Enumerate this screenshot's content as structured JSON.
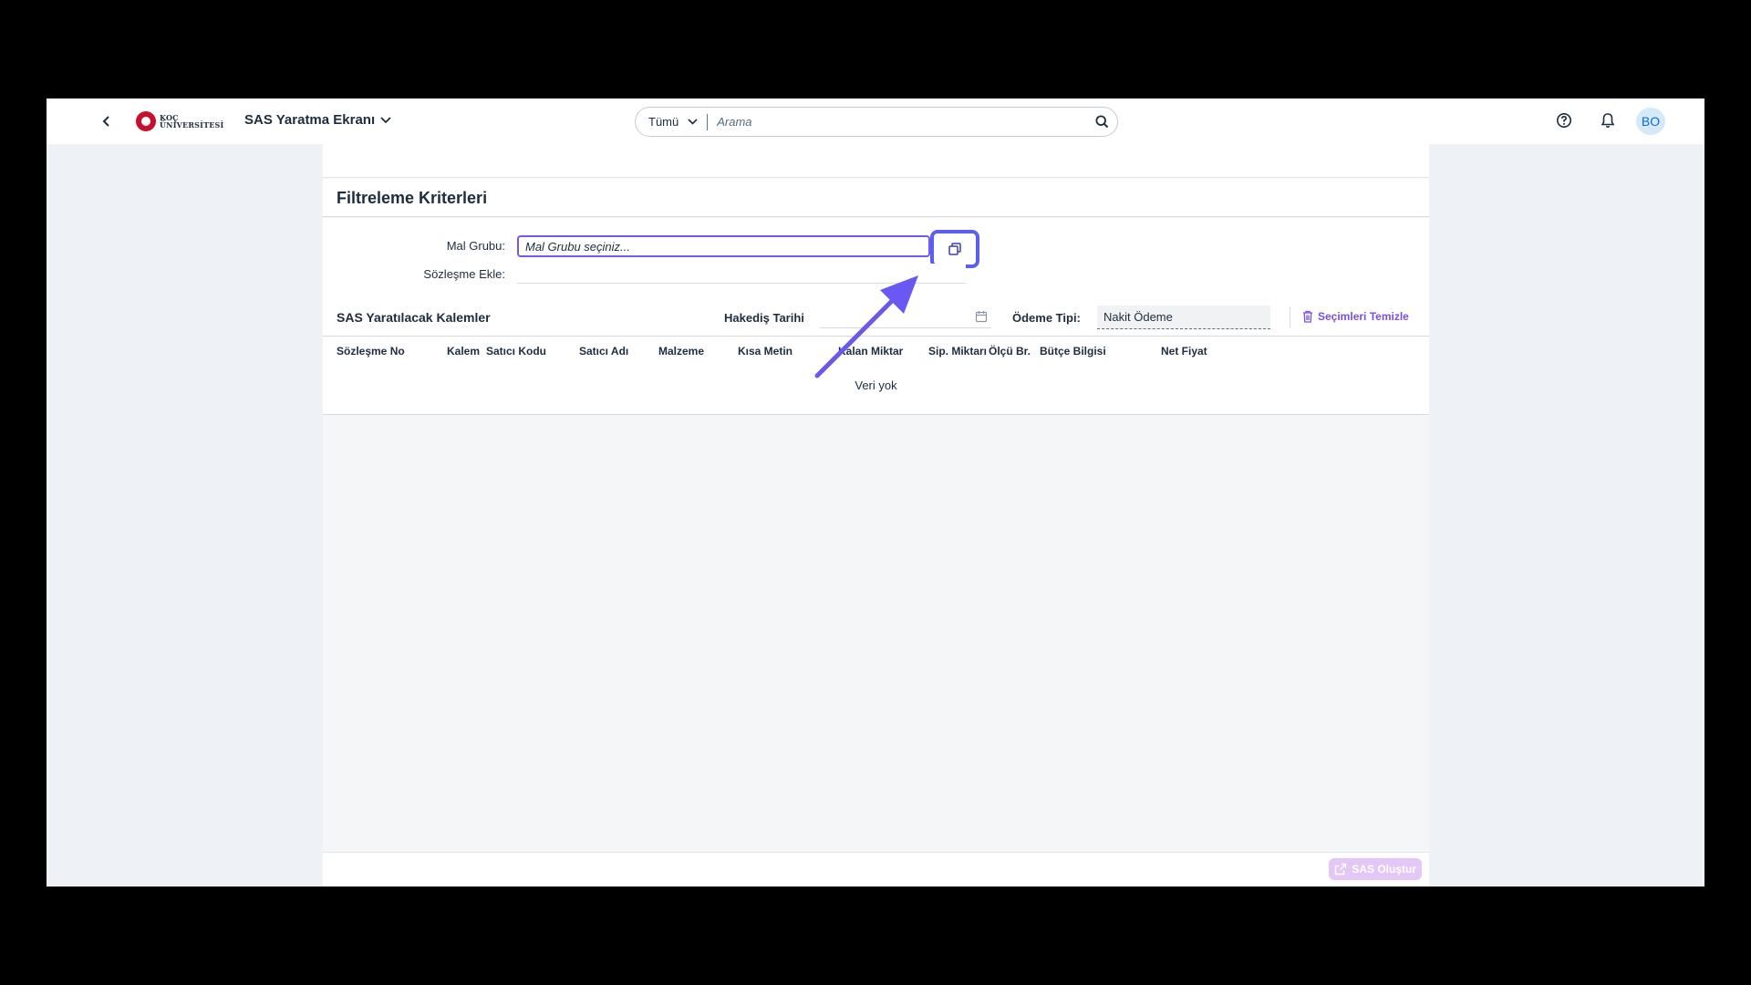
{
  "shell": {
    "logo_line1": "KOÇ",
    "logo_line2": "ÜNİVERSİTESİ",
    "app_title": "SAS Yaratma Ekranı",
    "search_scope": "Tümü",
    "search_placeholder": "Arama",
    "avatar_initials": "BO"
  },
  "filter": {
    "title": "Filtreleme Kriterleri",
    "mal_grubu_label": "Mal Grubu:",
    "mal_grubu_placeholder": "Mal Grubu seçiniz...",
    "sozlesme_label": "Sözleşme Ekle:"
  },
  "table": {
    "title": "SAS Yaratılacak Kalemler",
    "hakedis_label": "Hakediş Tarihi",
    "odeme_label": "Ödeme Tipi:",
    "odeme_value": "Nakit Ödeme",
    "clear_label": "Seçimleri Temizle",
    "columns": [
      "Sözleşme No",
      "Kalem",
      "Satıcı Kodu",
      "Satıcı Adı",
      "Malzeme",
      "Kısa Metin",
      "Kalan Miktar",
      "Sip. Miktarı",
      "Ölçü Br.",
      "Bütçe Bilgisi",
      "Net Fiyat"
    ],
    "no_data": "Veri yok"
  },
  "footer": {
    "create_label": "SAS Oluştur"
  },
  "colors": {
    "accent": "#7858e8",
    "highlight": "#5b5ff0",
    "clear_text": "#7b4ee4",
    "disabled_button": "#e4c6f7"
  }
}
